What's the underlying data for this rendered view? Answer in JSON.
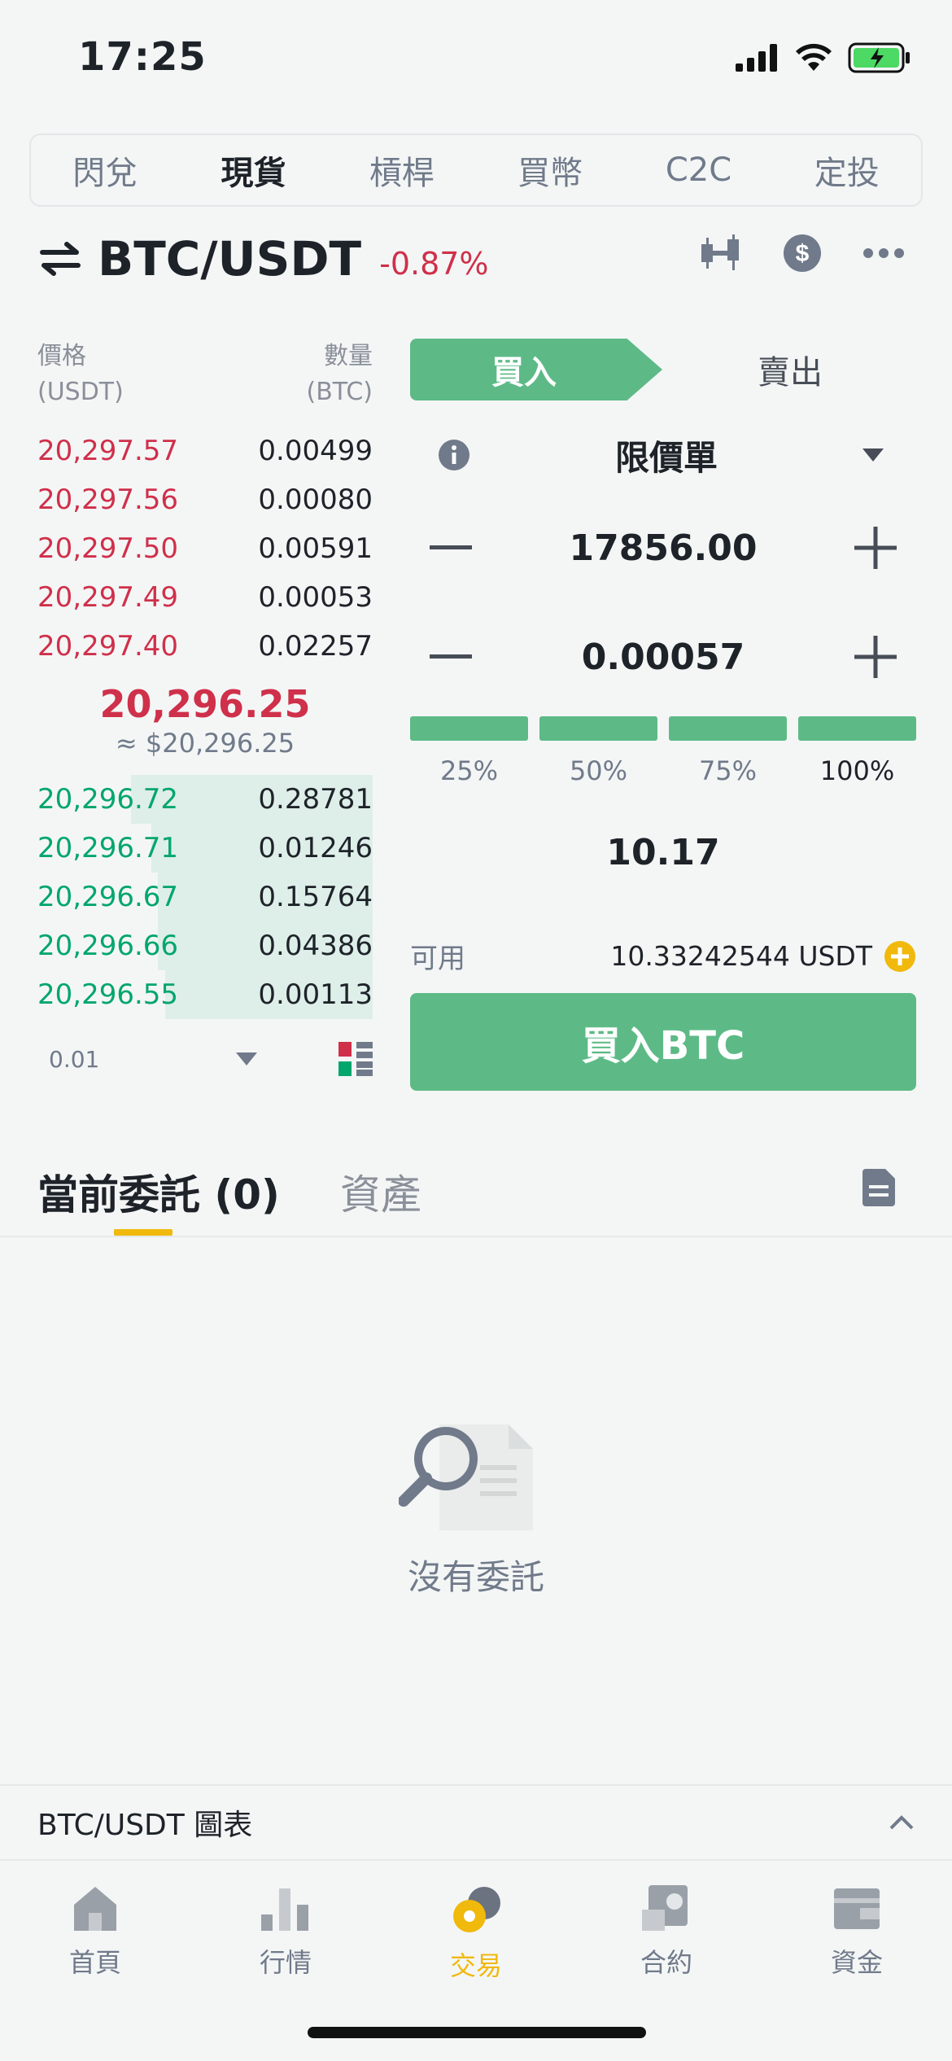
{
  "status": {
    "time": "17:25"
  },
  "segments": [
    "閃兌",
    "現貨",
    "槓桿",
    "買幣",
    "C2C",
    "定投"
  ],
  "pair": {
    "name": "BTC/USDT",
    "change": "-0.87%"
  },
  "orderbook": {
    "price_header": "價格",
    "price_unit": "(USDT)",
    "qty_header": "數量",
    "qty_unit": "(BTC)",
    "asks": [
      {
        "price": "20,297.57",
        "qty": "0.00499"
      },
      {
        "price": "20,297.56",
        "qty": "0.00080"
      },
      {
        "price": "20,297.50",
        "qty": "0.00591"
      },
      {
        "price": "20,297.49",
        "qty": "0.00053"
      },
      {
        "price": "20,297.40",
        "qty": "0.02257"
      }
    ],
    "mid_price": "20,296.25",
    "mid_fiat": "≈ $20,296.25",
    "bids": [
      {
        "price": "20,296.72",
        "qty": "0.28781"
      },
      {
        "price": "20,296.71",
        "qty": "0.01246"
      },
      {
        "price": "20,296.67",
        "qty": "0.15764"
      },
      {
        "price": "20,296.66",
        "qty": "0.04386"
      },
      {
        "price": "20,296.55",
        "qty": "0.00113"
      }
    ],
    "depth": "0.01"
  },
  "trade": {
    "buy_label": "買入",
    "sell_label": "賣出",
    "order_type": "限價單",
    "price": "17856.00",
    "amount": "0.00057",
    "percents": [
      "25%",
      "50%",
      "75%",
      "100%"
    ],
    "total": "10.17",
    "available_label": "可用",
    "available_value": "10.33242544 USDT",
    "buy_button": "買入BTC"
  },
  "orders": {
    "tab_open": "當前委託 (0)",
    "tab_assets": "資產",
    "empty_text": "沒有委託"
  },
  "chart_bar": {
    "title": "BTC/USDT 圖表"
  },
  "nav": [
    {
      "label": "首頁",
      "icon": "home-icon"
    },
    {
      "label": "行情",
      "icon": "markets-icon"
    },
    {
      "label": "交易",
      "icon": "trade-icon"
    },
    {
      "label": "合約",
      "icon": "futures-icon"
    },
    {
      "label": "資金",
      "icon": "wallet-icon"
    }
  ],
  "colors": {
    "buy": "#5dba86",
    "sell": "#cf304a",
    "accent": "#f0b90b"
  }
}
